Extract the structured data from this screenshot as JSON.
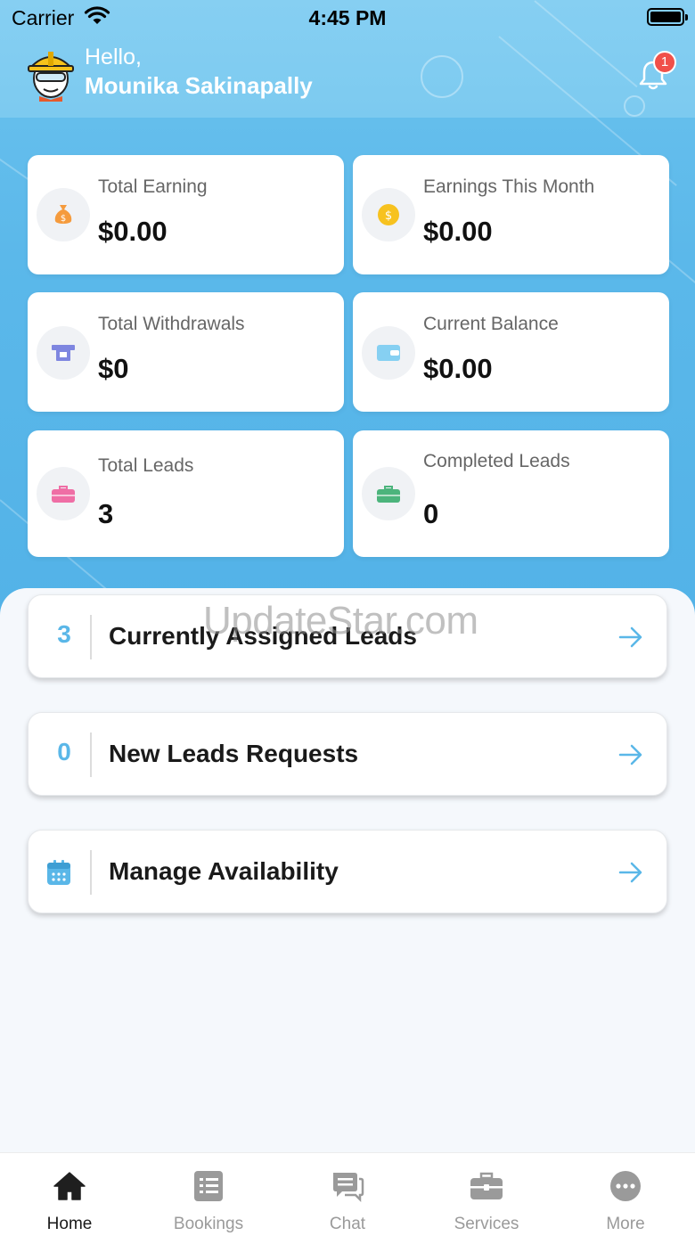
{
  "status_bar": {
    "carrier": "Carrier",
    "time": "4:45 PM"
  },
  "header": {
    "greeting": "Hello,",
    "user_name": "Mounika Sakinapally",
    "notification_count": "1"
  },
  "stats": [
    {
      "label": "Total Earning",
      "value": "$0.00",
      "icon": "money-bag-icon"
    },
    {
      "label": "Earnings This Month",
      "value": "$0.00",
      "icon": "coin-icon"
    },
    {
      "label": "Total Withdrawals",
      "value": "$0",
      "icon": "atm-icon"
    },
    {
      "label": "Current Balance",
      "value": "$0.00",
      "icon": "wallet-icon"
    },
    {
      "label": "Total Leads",
      "value": "3",
      "icon": "briefcase-icon"
    },
    {
      "label": "Completed Leads",
      "value": "0",
      "icon": "briefcase-icon"
    }
  ],
  "actions": [
    {
      "count": "3",
      "title": "Currently Assigned Leads"
    },
    {
      "count": "0",
      "title": "New Leads Requests"
    },
    {
      "count": "",
      "title": "Manage Availability",
      "icon": "calendar-icon"
    }
  ],
  "watermark": "UpdateStar.com",
  "tabs": [
    {
      "label": "Home",
      "icon": "home-icon",
      "active": true
    },
    {
      "label": "Bookings",
      "icon": "list-icon"
    },
    {
      "label": "Chat",
      "icon": "chat-icon"
    },
    {
      "label": "Services",
      "icon": "briefcase-icon"
    },
    {
      "label": "More",
      "icon": "more-icon"
    }
  ],
  "colors": {
    "primary": "#5ab7e8",
    "header": "#86cff2",
    "badge": "#f0504a",
    "card": "#ffffff",
    "background": "#f5f8fc"
  }
}
